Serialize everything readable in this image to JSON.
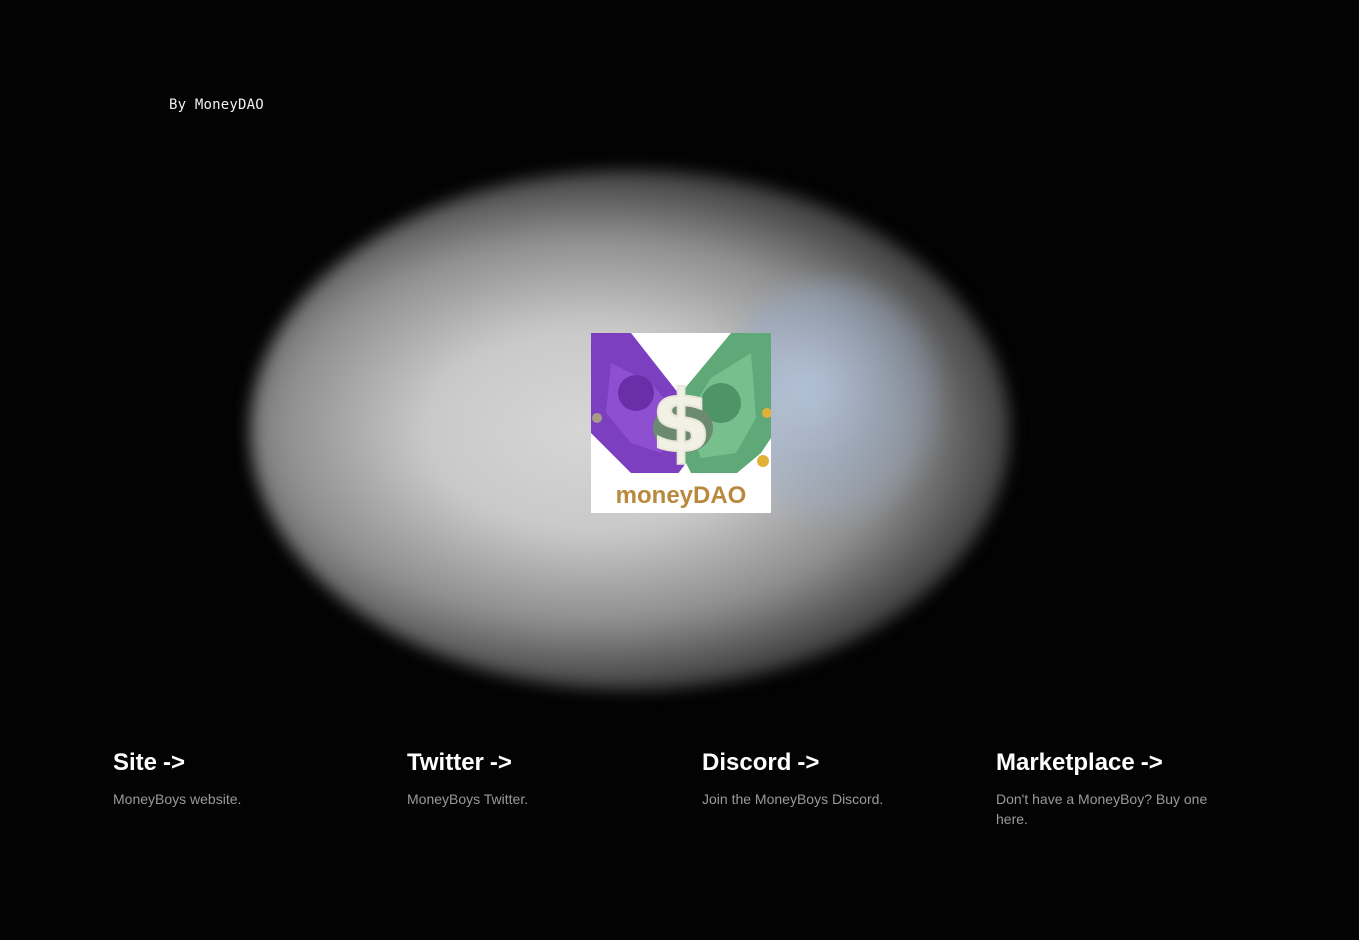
{
  "header": {
    "byline": "By MoneyDAO"
  },
  "hero": {
    "logo_text": "moneyDAO",
    "logo_symbol": "$",
    "logo_icon": "moneydao-logo-icon"
  },
  "cards": [
    {
      "title": "Site",
      "arrow": "->",
      "description": "MoneyBoys website."
    },
    {
      "title": "Twitter",
      "arrow": "->",
      "description": "MoneyBoys Twitter."
    },
    {
      "title": "Discord",
      "arrow": "->",
      "description": "Join the MoneyBoys Discord."
    },
    {
      "title": "Marketplace",
      "arrow": "->",
      "description": "Don't have a MoneyBoy? Buy one here."
    }
  ],
  "colors": {
    "background": "#030303",
    "text": "#ffffff",
    "muted_text": "#9a9a9a",
    "logo_purple": "#7b3fbf",
    "logo_green": "#5fa978",
    "logo_gold": "#b98a3e"
  }
}
